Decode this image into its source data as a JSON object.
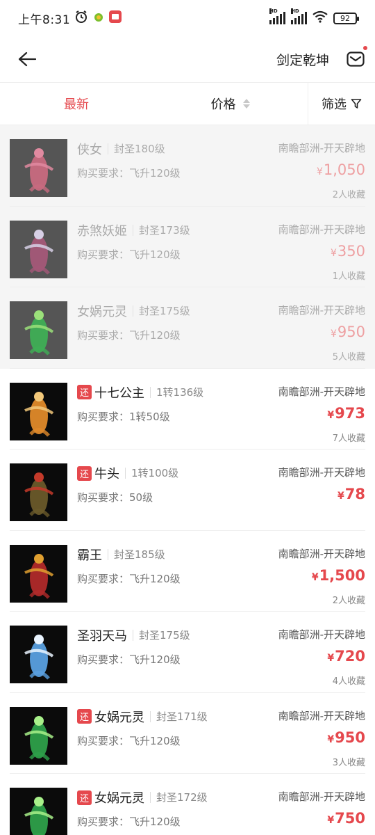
{
  "status_bar": {
    "time": "上午8:31",
    "battery": "92"
  },
  "header": {
    "title": "剑定乾坤"
  },
  "filters": {
    "latest": "最新",
    "price": "价格",
    "filter": "筛选"
  },
  "items": [
    {
      "tag": "",
      "name": "侠女",
      "level": "封圣180级",
      "requirement": "购买要求：飞升120级",
      "server": "南瞻部洲-开天辟地",
      "price_symbol": "¥",
      "price": "1,050",
      "favorites": "2人收藏",
      "sold": true
    },
    {
      "tag": "",
      "name": "赤煞妖姬",
      "level": "封圣173级",
      "requirement": "购买要求：飞升120级",
      "server": "南瞻部洲-开天辟地",
      "price_symbol": "¥",
      "price": "350",
      "favorites": "1人收藏",
      "sold": true
    },
    {
      "tag": "",
      "name": "女娲元灵",
      "level": "封圣175级",
      "requirement": "购买要求：飞升120级",
      "server": "南瞻部洲-开天辟地",
      "price_symbol": "¥",
      "price": "950",
      "favorites": "5人收藏",
      "sold": true
    },
    {
      "tag": "还",
      "name": "十七公主",
      "level": "1转136级",
      "requirement": "购买要求：1转50级",
      "server": "南瞻部洲-开天辟地",
      "price_symbol": "¥",
      "price": "973",
      "favorites": "7人收藏",
      "sold": false
    },
    {
      "tag": "还",
      "name": "牛头",
      "level": "1转100级",
      "requirement": "购买要求：50级",
      "server": "南瞻部洲-开天辟地",
      "price_symbol": "¥",
      "price": "78",
      "favorites": "",
      "sold": false
    },
    {
      "tag": "",
      "name": "霸王",
      "level": "封圣185级",
      "requirement": "购买要求：飞升120级",
      "server": "南瞻部洲-开天辟地",
      "price_symbol": "¥",
      "price": "1,500",
      "favorites": "2人收藏",
      "sold": false
    },
    {
      "tag": "",
      "name": "圣羽天马",
      "level": "封圣175级",
      "requirement": "购买要求：飞升120级",
      "server": "南瞻部洲-开天辟地",
      "price_symbol": "¥",
      "price": "720",
      "favorites": "4人收藏",
      "sold": false
    },
    {
      "tag": "还",
      "name": "女娲元灵",
      "level": "封圣171级",
      "requirement": "购买要求：飞升120级",
      "server": "南瞻部洲-开天辟地",
      "price_symbol": "¥",
      "price": "950",
      "favorites": "3人收藏",
      "sold": false
    },
    {
      "tag": "还",
      "name": "女娲元灵",
      "level": "封圣172级",
      "requirement": "购买要求：飞升120级",
      "server": "南瞻部洲-开天辟地",
      "price_symbol": "¥",
      "price": "750",
      "favorites": "",
      "sold": false
    }
  ],
  "colors": {
    "accent": "#e5484d",
    "sold_background": "#f5f5f5"
  }
}
